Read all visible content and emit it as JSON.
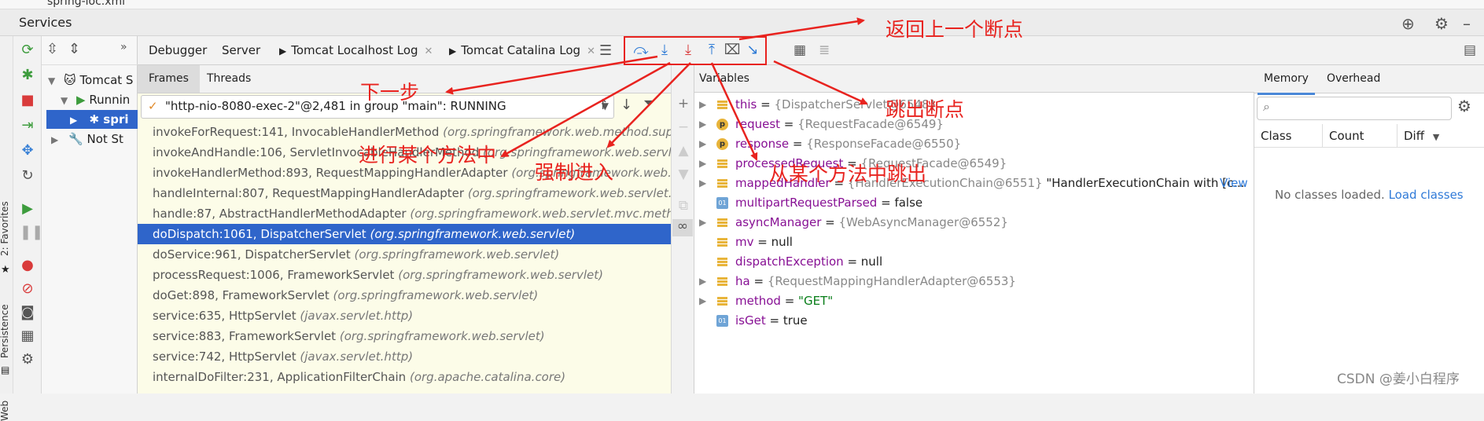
{
  "top_strip": {
    "path": "spring-ioc.xml"
  },
  "window": {
    "title": "Services"
  },
  "left_strip": {
    "favorites": "2: Favorites",
    "persistence": "Persistence",
    "web": "Web"
  },
  "tree": {
    "nodes": [
      {
        "label": "Tomcat S",
        "expanded": true
      },
      {
        "label": "Runnin",
        "expanded": true
      },
      {
        "label": "spri",
        "selected": true
      },
      {
        "label": "Not St",
        "expanded": false
      }
    ]
  },
  "tabs": [
    {
      "label": "Debugger",
      "active": true
    },
    {
      "label": "Server"
    },
    {
      "label": "Tomcat Localhost Log",
      "closable": true
    },
    {
      "label": "Tomcat Catalina Log",
      "closable": true
    }
  ],
  "frames_tabs": {
    "frames": "Frames",
    "threads": "Threads"
  },
  "thread_selector": "\"http-nio-8080-exec-2\"@2,481 in group \"main\": RUNNING",
  "frames": [
    {
      "method": "invokeForRequest:141, InvocableHandlerMethod",
      "pkg": "(org.springframework.web.method.supp"
    },
    {
      "method": "invokeAndHandle:106, ServletInvocableHandlerMethod",
      "pkg": "(org.springframework.web.servlet"
    },
    {
      "method": "invokeHandlerMethod:893, RequestMappingHandlerAdapter",
      "pkg": "(org.springframework.web.se"
    },
    {
      "method": "handleInternal:807, RequestMappingHandlerAdapter",
      "pkg": "(org.springframework.web.servlet.m"
    },
    {
      "method": "handle:87, AbstractHandlerMethodAdapter",
      "pkg": "(org.springframework.web.servlet.mvc.metho"
    },
    {
      "method": "doDispatch:1061, DispatcherServlet",
      "pkg": "(org.springframework.web.servlet)",
      "selected": true
    },
    {
      "method": "doService:961, DispatcherServlet",
      "pkg": "(org.springframework.web.servlet)"
    },
    {
      "method": "processRequest:1006, FrameworkServlet",
      "pkg": "(org.springframework.web.servlet)"
    },
    {
      "method": "doGet:898, FrameworkServlet",
      "pkg": "(org.springframework.web.servlet)"
    },
    {
      "method": "service:635, HttpServlet",
      "pkg": "(javax.servlet.http)"
    },
    {
      "method": "service:883, FrameworkServlet",
      "pkg": "(org.springframework.web.servlet)"
    },
    {
      "method": "service:742, HttpServlet",
      "pkg": "(javax.servlet.http)"
    },
    {
      "method": "internalDoFilter:231, ApplicationFilterChain",
      "pkg": "(org.apache.catalina.core)"
    }
  ],
  "variables_header": "Variables",
  "variables": [
    {
      "icon": "field",
      "expandable": true,
      "name": "this",
      "value": "{DispatcherServlet@6548}"
    },
    {
      "icon": "param",
      "expandable": true,
      "name": "request",
      "value": "{RequestFacade@6549}"
    },
    {
      "icon": "param",
      "expandable": true,
      "name": "response",
      "value": "{ResponseFacade@6550}"
    },
    {
      "icon": "field",
      "expandable": true,
      "name": "processedRequest",
      "value": "{RequestFacade@6549}"
    },
    {
      "icon": "field",
      "expandable": true,
      "name": "mappedHandler",
      "value": "{HandlerExecutionChain@6551}",
      "extra": "\"HandlerExecutionChain with [c...",
      "link": "View"
    },
    {
      "icon": "prim",
      "expandable": false,
      "name": "multipartRequestParsed",
      "value": "false"
    },
    {
      "icon": "field",
      "expandable": true,
      "name": "asyncManager",
      "value": "{WebAsyncManager@6552}"
    },
    {
      "icon": "field",
      "expandable": false,
      "name": "mv",
      "value": "null"
    },
    {
      "icon": "field",
      "expandable": false,
      "name": "dispatchException",
      "value": "null"
    },
    {
      "icon": "field",
      "expandable": true,
      "name": "ha",
      "value": "{RequestMappingHandlerAdapter@6553}"
    },
    {
      "icon": "field",
      "expandable": true,
      "name": "method",
      "value": "\"GET\""
    },
    {
      "icon": "prim",
      "expandable": false,
      "name": "isGet",
      "value": "true"
    }
  ],
  "memory": {
    "tabs": [
      "Memory",
      "Overhead"
    ],
    "columns": [
      "Class",
      "Count",
      "Diff"
    ],
    "empty_text": "No classes loaded.",
    "load_link": "Load classes"
  },
  "annotations": {
    "return_prev": "返回上一个断点",
    "next_step": "下一步",
    "step_into": "进行某个方法中",
    "force_into": "强制进入",
    "exit_breakpoint": "跳出断点",
    "step_out": "从某个方法中跳出"
  },
  "watermark": "CSDN @姜小白程序",
  "colors": {
    "accent": "#2f65ca",
    "annotation": "#e8231f",
    "frames_bg": "#fcfce8"
  }
}
